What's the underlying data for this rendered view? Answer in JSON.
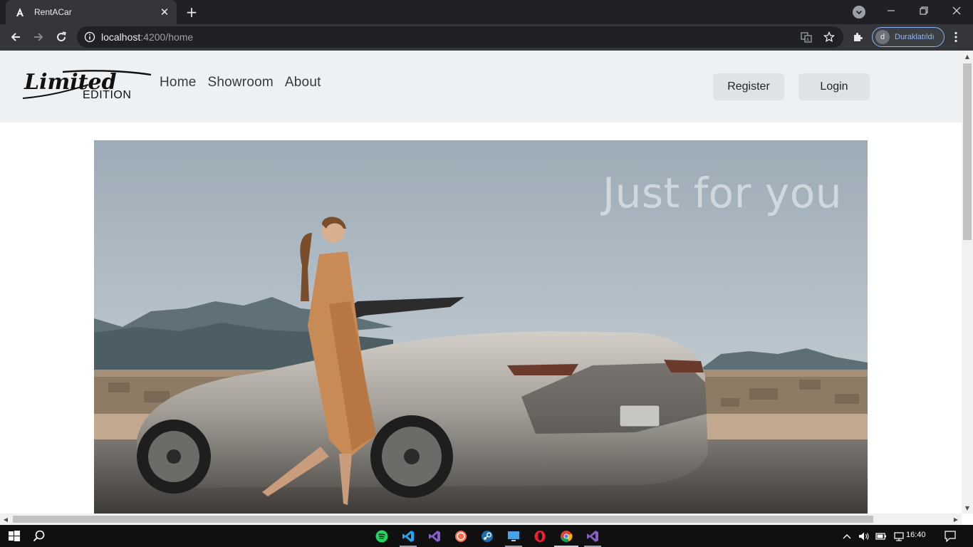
{
  "browser": {
    "tab_title": "RentACar",
    "new_tab_symbol": "+",
    "close_symbol": "✕",
    "url_host": "localhost",
    "url_path": ":4200/home",
    "profile_initial": "d",
    "profile_label": "Duraklatıldı",
    "menu_symbol": "⋮"
  },
  "site": {
    "brand": {
      "script": "Limited",
      "sub": "EDITION"
    },
    "nav": [
      "Home",
      "Showroom",
      "About"
    ],
    "register_label": "Register",
    "login_label": "Login",
    "hero_headline": "Just for you"
  },
  "taskbar": {
    "clock": "16:40",
    "apps": [
      "spotify-icon",
      "vscode-icon",
      "visual-studio-icon",
      "osu-icon",
      "steam-icon",
      "remote-desktop-icon",
      "opera-icon",
      "chrome-icon",
      "visual-studio-2-icon"
    ]
  },
  "colors": {
    "header_bg": "#eef1f4",
    "button_bg": "#dfe3e7",
    "chrome_dark": "#202124",
    "accent_blue": "#8ab4f8"
  }
}
